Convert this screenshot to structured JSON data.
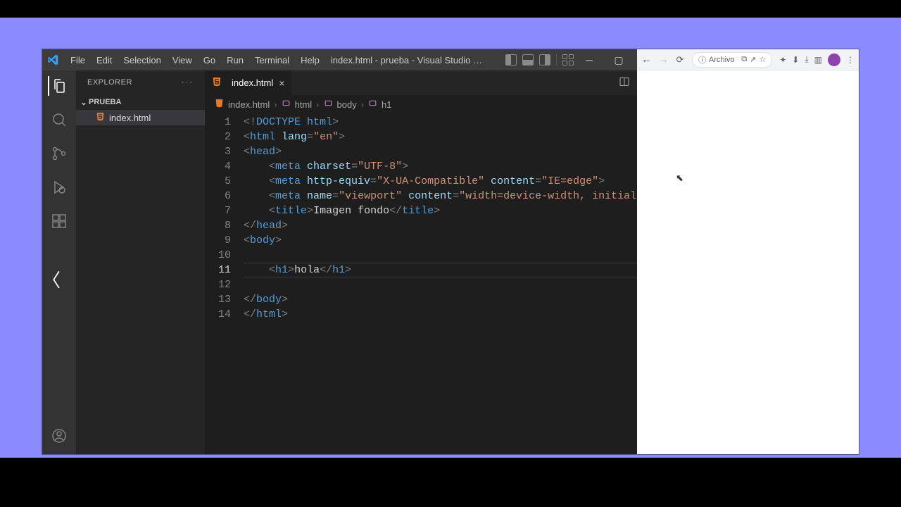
{
  "vscode": {
    "menu": [
      "File",
      "Edit",
      "Selection",
      "View",
      "Go",
      "Run",
      "Terminal",
      "Help"
    ],
    "title": "index.html - prueba - Visual Studio …",
    "explorer": {
      "header": "EXPLORER",
      "folder": "PRUEBA",
      "files": [
        "index.html"
      ]
    },
    "tab": {
      "name": "index.html"
    },
    "breadcrumbs": [
      "index.html",
      "html",
      "body",
      "h1"
    ],
    "code": {
      "currentLine": 11,
      "lines": [
        {
          "n": 1,
          "t": [
            [
              "br",
              "<!"
            ],
            [
              "doct",
              "DOCTYPE "
            ],
            [
              "tag",
              "html"
            ],
            [
              "br",
              ">"
            ]
          ]
        },
        {
          "n": 2,
          "t": [
            [
              "br",
              "<"
            ],
            [
              "tag",
              "html "
            ],
            [
              "attr",
              "lang"
            ],
            [
              "br",
              "="
            ],
            [
              "str",
              "\"en\""
            ],
            [
              "br",
              ">"
            ]
          ]
        },
        {
          "n": 3,
          "t": [
            [
              "br",
              "<"
            ],
            [
              "tag",
              "head"
            ],
            [
              "br",
              ">"
            ]
          ]
        },
        {
          "n": 4,
          "t": [
            [
              "text",
              "    "
            ],
            [
              "br",
              "<"
            ],
            [
              "tag",
              "meta "
            ],
            [
              "attr",
              "charset"
            ],
            [
              "br",
              "="
            ],
            [
              "str",
              "\"UTF-8\""
            ],
            [
              "br",
              ">"
            ]
          ]
        },
        {
          "n": 5,
          "t": [
            [
              "text",
              "    "
            ],
            [
              "br",
              "<"
            ],
            [
              "tag",
              "meta "
            ],
            [
              "attr",
              "http-equiv"
            ],
            [
              "br",
              "="
            ],
            [
              "str",
              "\"X-UA-Compatible\""
            ],
            [
              "text",
              " "
            ],
            [
              "attr",
              "content"
            ],
            [
              "br",
              "="
            ],
            [
              "str",
              "\"IE=edge\""
            ],
            [
              "br",
              ">"
            ]
          ]
        },
        {
          "n": 6,
          "t": [
            [
              "text",
              "    "
            ],
            [
              "br",
              "<"
            ],
            [
              "tag",
              "meta "
            ],
            [
              "attr",
              "name"
            ],
            [
              "br",
              "="
            ],
            [
              "str",
              "\"viewport\""
            ],
            [
              "text",
              " "
            ],
            [
              "attr",
              "content"
            ],
            [
              "br",
              "="
            ],
            [
              "str",
              "\"width=device-width, initial-s"
            ]
          ]
        },
        {
          "n": 7,
          "t": [
            [
              "text",
              "    "
            ],
            [
              "br",
              "<"
            ],
            [
              "tag",
              "title"
            ],
            [
              "br",
              ">"
            ],
            [
              "text",
              "Imagen fondo"
            ],
            [
              "br",
              "</"
            ],
            [
              "tag",
              "title"
            ],
            [
              "br",
              ">"
            ]
          ]
        },
        {
          "n": 8,
          "t": [
            [
              "br",
              "</"
            ],
            [
              "tag",
              "head"
            ],
            [
              "br",
              ">"
            ]
          ]
        },
        {
          "n": 9,
          "t": [
            [
              "br",
              "<"
            ],
            [
              "tag",
              "body"
            ],
            [
              "br",
              ">"
            ]
          ]
        },
        {
          "n": 10,
          "t": [
            [
              "text",
              ""
            ]
          ]
        },
        {
          "n": 11,
          "t": [
            [
              "text",
              "    "
            ],
            [
              "br",
              "<"
            ],
            [
              "tag",
              "h1"
            ],
            [
              "br",
              ">"
            ],
            [
              "text",
              "hola"
            ],
            [
              "br",
              "</"
            ],
            [
              "tag",
              "h1"
            ],
            [
              "br",
              ">"
            ]
          ]
        },
        {
          "n": 12,
          "t": [
            [
              "text",
              ""
            ]
          ]
        },
        {
          "n": 13,
          "t": [
            [
              "br",
              "</"
            ],
            [
              "tag",
              "body"
            ],
            [
              "br",
              ">"
            ]
          ]
        },
        {
          "n": 14,
          "t": [
            [
              "br",
              "</"
            ],
            [
              "tag",
              "html"
            ],
            [
              "br",
              ">"
            ]
          ]
        }
      ]
    }
  },
  "browser": {
    "addr_label": "Archivo"
  }
}
